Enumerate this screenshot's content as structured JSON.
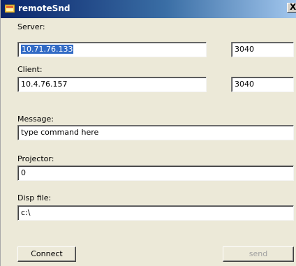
{
  "window": {
    "title": "remoteSnd",
    "close_glyph": "X"
  },
  "server": {
    "label": "Server:",
    "address": "10.71.76.133",
    "port": "3040"
  },
  "client": {
    "label": "Client:",
    "address": "10.4.76.157",
    "port": "3040"
  },
  "message": {
    "label": "Message:",
    "value": "type command here"
  },
  "projector": {
    "label": "Projector:",
    "value": "0"
  },
  "disp_file": {
    "label": "Disp file:",
    "value": "c:\\"
  },
  "buttons": {
    "connect": "Connect",
    "send": "send"
  },
  "colors": {
    "title_gradient_start": "#0a246a",
    "title_gradient_end": "#a6caf0",
    "window_bg": "#ece9d8",
    "selection": "#316ac5"
  },
  "icons": {
    "app": "app-window-icon",
    "close": "close-icon"
  }
}
